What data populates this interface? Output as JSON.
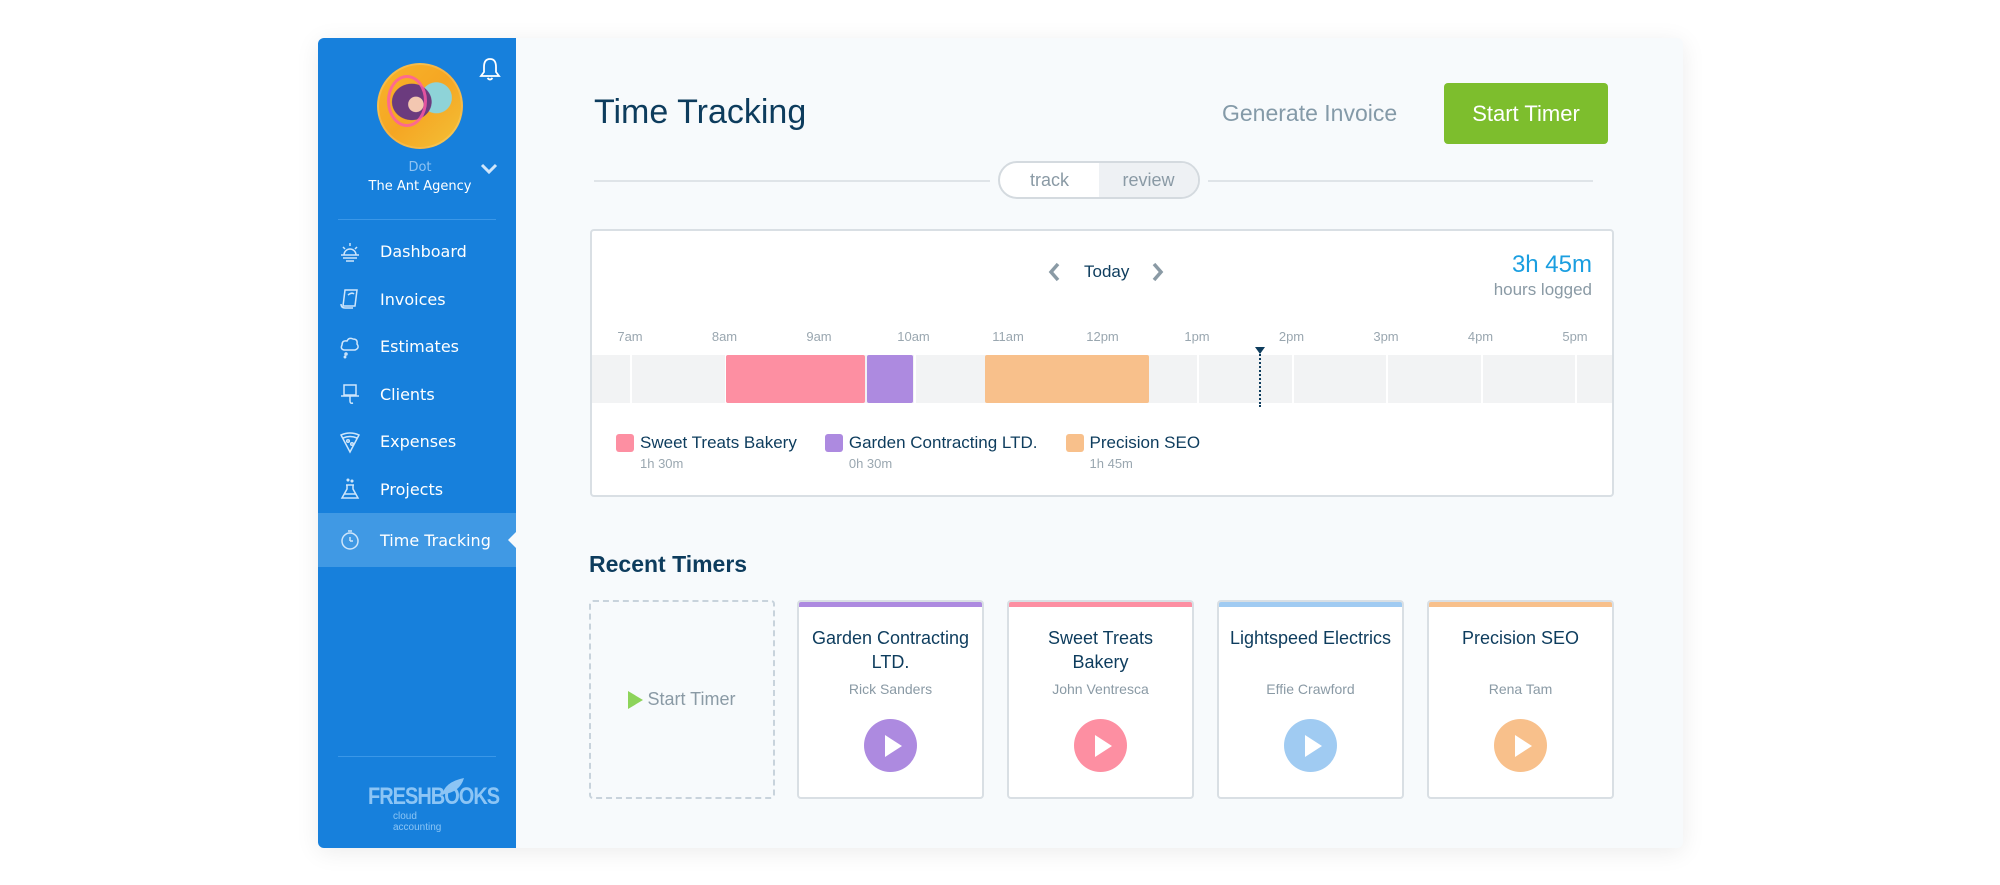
{
  "sidebar": {
    "user": {
      "name": "Dot",
      "agency": "The Ant Agency"
    },
    "items": [
      {
        "label": "Dashboard",
        "icon": "dashboard-sun-icon"
      },
      {
        "label": "Invoices",
        "icon": "invoice-scroll-icon"
      },
      {
        "label": "Estimates",
        "icon": "estimate-cloud-icon"
      },
      {
        "label": "Clients",
        "icon": "client-hat-icon"
      },
      {
        "label": "Expenses",
        "icon": "expense-pizza-icon"
      },
      {
        "label": "Projects",
        "icon": "project-flask-icon"
      },
      {
        "label": "Time Tracking",
        "icon": "stopwatch-icon",
        "active": true
      }
    ],
    "logo": {
      "name": "FRESHBOOKS",
      "tagline": "cloud accounting"
    }
  },
  "header": {
    "title": "Time Tracking",
    "generate_invoice": "Generate Invoice",
    "start_timer": "Start Timer",
    "toggle": {
      "options": [
        "track",
        "review"
      ],
      "selected": "review"
    }
  },
  "timeline": {
    "day_label": "Today",
    "total": "3h 45m",
    "total_label": "hours logged",
    "hours": [
      "7am",
      "8am",
      "9am",
      "10am",
      "11am",
      "12pm",
      "1pm",
      "2pm",
      "3pm",
      "4pm",
      "5pm"
    ],
    "current_time_hour": 13.65,
    "entries": [
      {
        "client": "Sweet Treats Bakery",
        "start_hour": 8.0,
        "end_hour": 9.5,
        "color": "#fd8fa2"
      },
      {
        "client": "Garden Contracting LTD.",
        "start_hour": 9.5,
        "end_hour": 10.0,
        "color": "#ad8ae0"
      },
      {
        "client": "Precision SEO",
        "start_hour": 10.75,
        "end_hour": 12.5,
        "color": "#f8c08b"
      }
    ],
    "legend": [
      {
        "name": "Sweet Treats Bakery",
        "duration": "1h 30m",
        "color": "#fd8fa2"
      },
      {
        "name": "Garden Contracting LTD.",
        "duration": "0h 30m",
        "color": "#ad8ae0"
      },
      {
        "name": "Precision SEO",
        "duration": "1h 45m",
        "color": "#f8c08b"
      }
    ]
  },
  "recent": {
    "title": "Recent Timers",
    "new_timer_label": "Start Timer",
    "cards": [
      {
        "client": "Garden Contracting LTD.",
        "person": "Rick Sanders",
        "color": "#ad8ae0"
      },
      {
        "client": "Sweet Treats Bakery",
        "person": "John Ventresca",
        "color": "#fd8fa2"
      },
      {
        "client": "Lightspeed Electrics",
        "person": "Effie Crawford",
        "color": "#a0cbf2"
      },
      {
        "client": "Precision SEO",
        "person": "Rena Tam",
        "color": "#f8c08b"
      }
    ]
  }
}
